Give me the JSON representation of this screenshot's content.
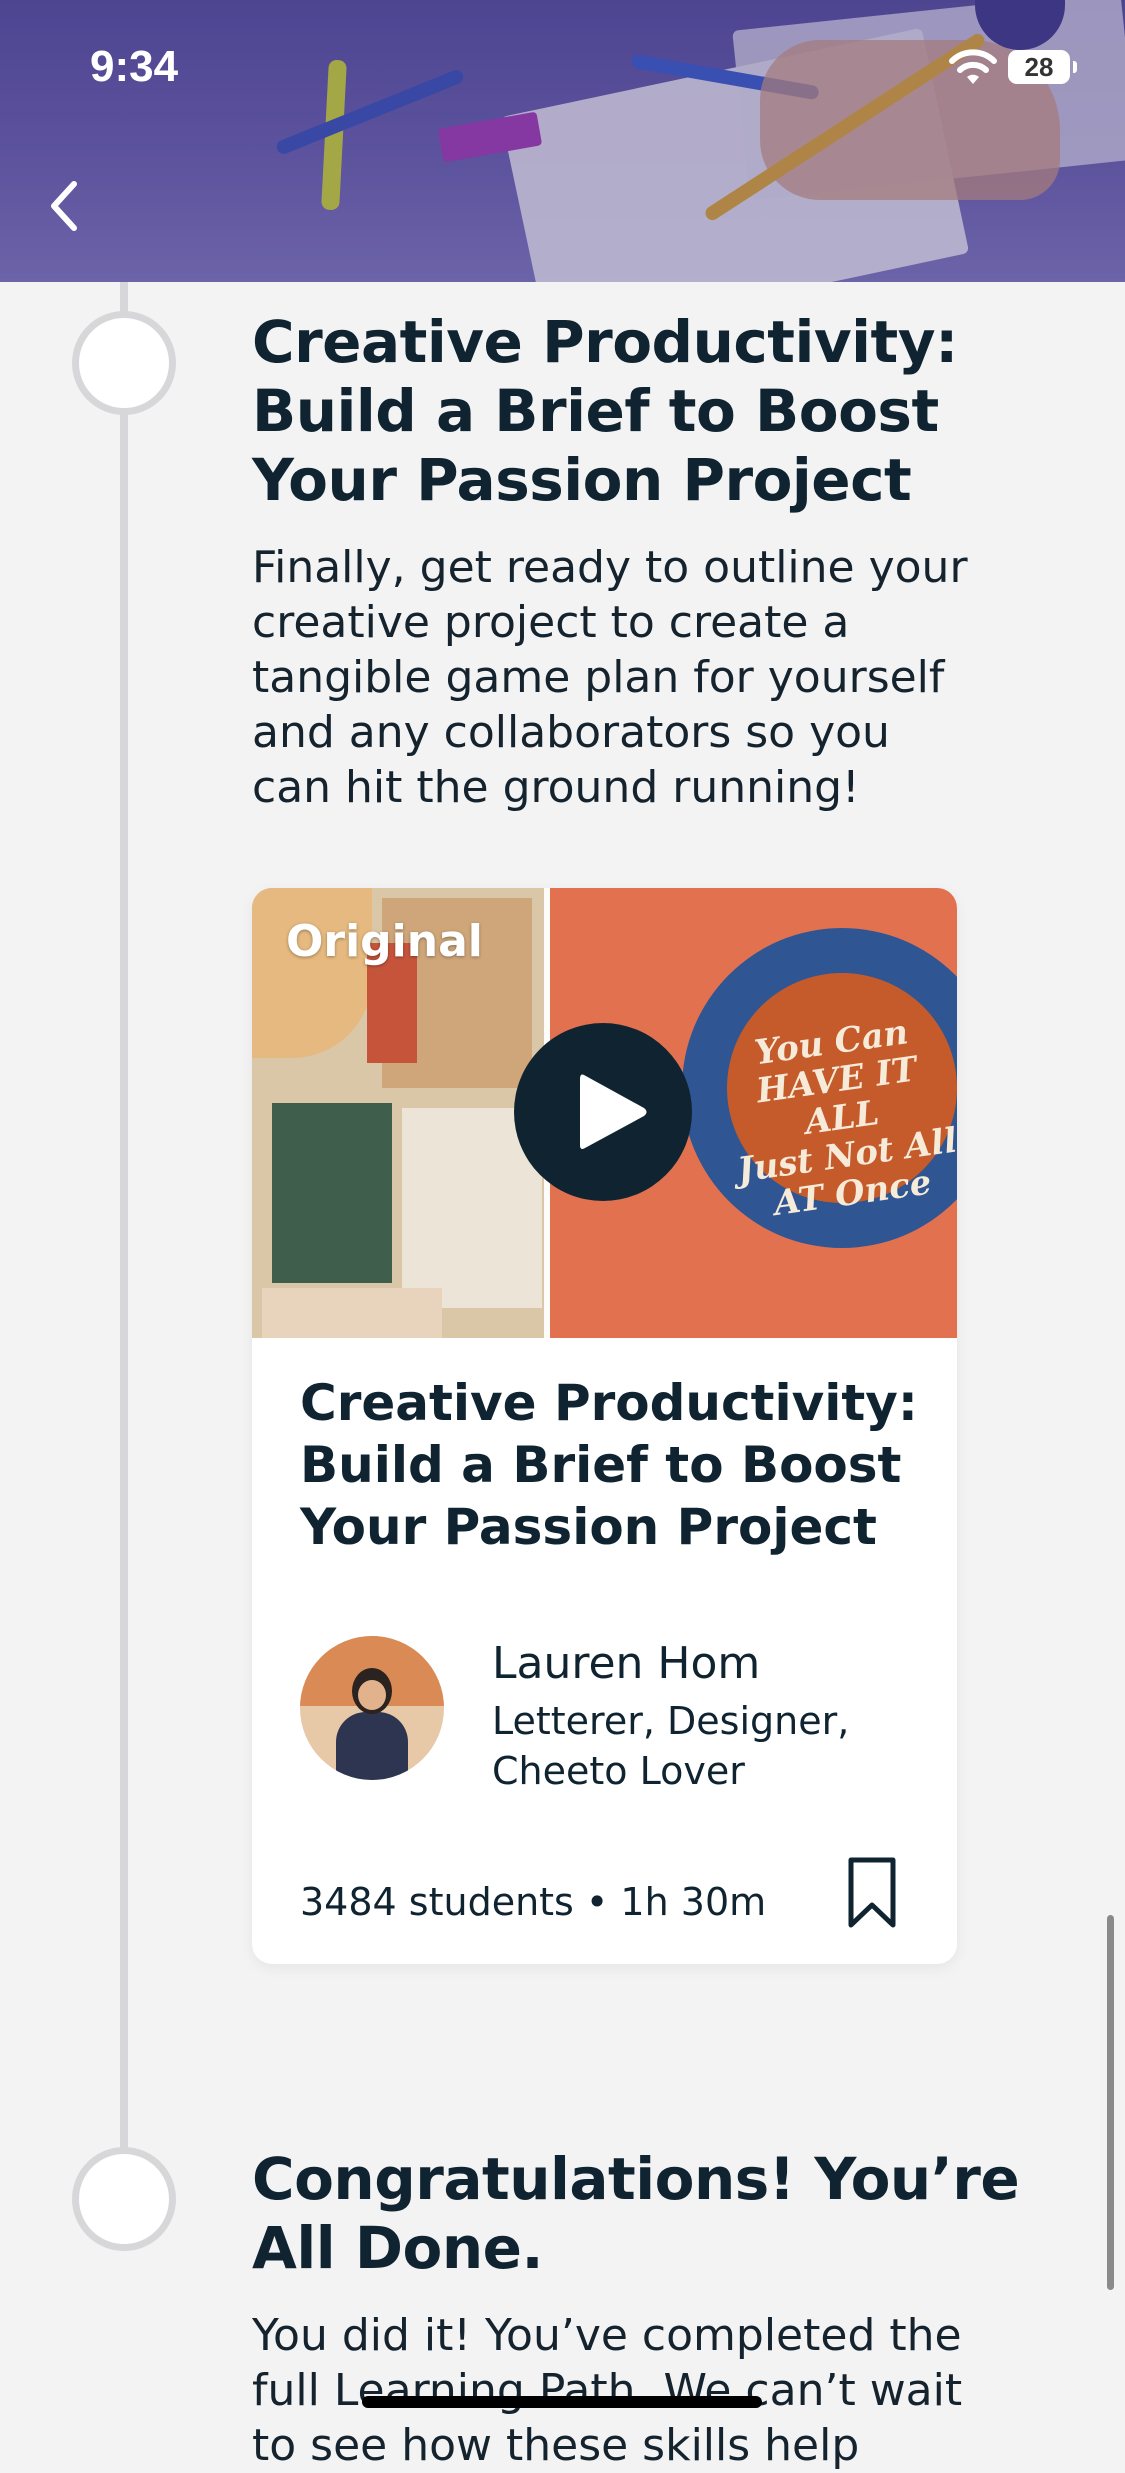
{
  "status_bar": {
    "time": "9:34",
    "battery": "28"
  },
  "nav": {
    "back_icon": "chevron-left-icon"
  },
  "steps": [
    {
      "title": "Creative Productivity:\nBuild a Brief to Boost\nYour Passion Project",
      "description": "Finally, get ready to outline your creative project to create a tangible game plan for yourself and any collaborators so you can hit the ground running!"
    },
    {
      "title": "Congratulations! You’re\nAll Done.",
      "description": "You did it! You’ve completed the full Learning Path. We can’t wait to see how these skills help"
    }
  ],
  "class_card": {
    "badge": "Original",
    "thumbnail_text": "You Can\nHAVE IT ALL\nJust Not All\nAT Once",
    "title": "Creative Productivity:\nBuild a Brief to Boost\nYour Passion Project",
    "teacher": {
      "name": "Lauren Hom",
      "role": "Letterer, Designer,\nCheeto Lover"
    },
    "meta": "3484 students • 1h 30m",
    "bookmark_icon": "bookmark-icon",
    "play_icon": "play-icon"
  },
  "colors": {
    "text_primary": "#0f2430",
    "background": "#f3f3f3",
    "timeline": "#d7d7d9",
    "card": "#ffffff"
  }
}
